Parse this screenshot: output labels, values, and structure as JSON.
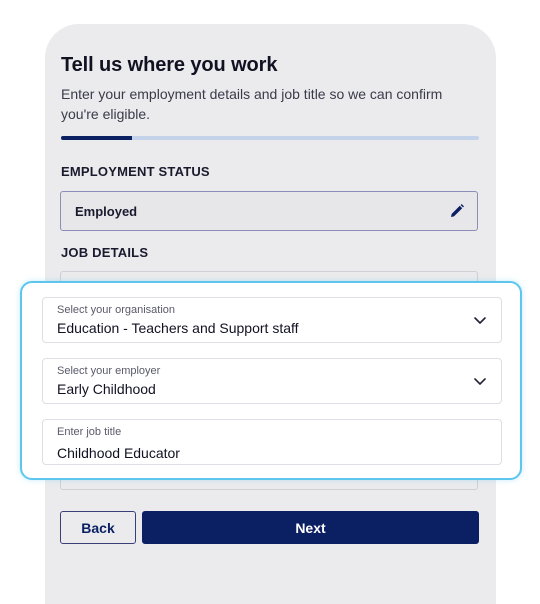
{
  "header": {
    "title": "Tell us where you work",
    "subtitle": "Enter your employment details and job title so we can confirm you're eligible."
  },
  "progress": {
    "fraction": 0.17
  },
  "employment": {
    "section_label": "EMPLOYMENT STATUS",
    "value": "Employed",
    "edit_icon": "pencil-icon"
  },
  "job_details": {
    "section_label": "JOB DETAILS",
    "organisation": {
      "label": "Select your organisation",
      "value": "Education - Teachers and Support staff"
    },
    "employer": {
      "label": "Select your employer",
      "value": "Early Childhood"
    },
    "job_title": {
      "label": "Enter job title",
      "value": "Childhood Educator"
    }
  },
  "buttons": {
    "back_label": "Back",
    "next_label": "Next"
  },
  "colors": {
    "primary": "#0b1f63",
    "highlight": "#5cc6ee",
    "progress_track": "#c4d3ea",
    "card_background": "#ebebed"
  }
}
